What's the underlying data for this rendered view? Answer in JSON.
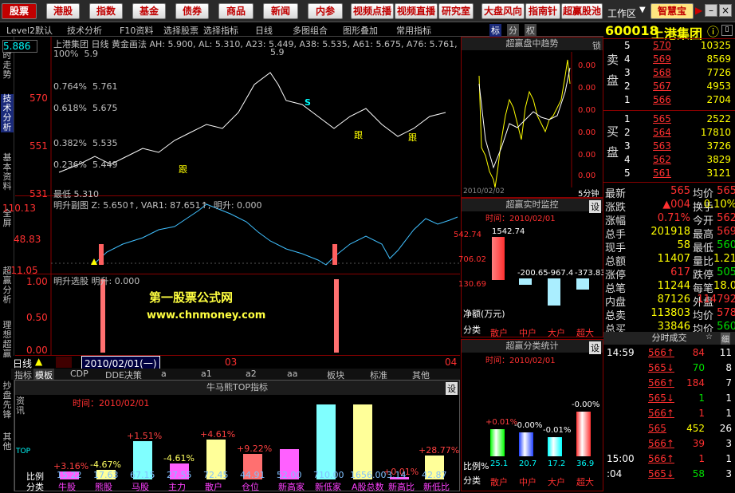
{
  "topbar": {
    "buttons": [
      "股票",
      "港股",
      "指数",
      "基金",
      "债券",
      "商品",
      "新闻",
      "内参",
      "视频点播",
      "视频直播",
      "研究室",
      "大盘风向",
      "指南针",
      "超赢股池"
    ],
    "workspace": "工作区",
    "smart": "智慧宝"
  },
  "toolrow": {
    "items": [
      "Level2默认",
      "技术分析",
      "F10资料",
      "选择股票",
      "选择指标",
      "日线",
      "多图组合",
      "图形叠加",
      "常用指标"
    ],
    "tabs": [
      "标",
      "分",
      "权"
    ]
  },
  "lefttabs": [
    "分时走势",
    "技术分析",
    "基本资料",
    "全屏",
    "超赢分析",
    "理想超赢"
  ],
  "stock": {
    "code": "600018",
    "name": "上港集团",
    "right_icon": "ⓘ"
  },
  "kline": {
    "header": "上港集团 日线 黄金画法 AH: 5.900, AL: 5.310, A23: 5.449, A38: 5.535, A61: 5.675, A76: 5.761, MA2: 5",
    "ylabels": [
      "5.886",
      "570",
      "551",
      "531"
    ],
    "fib": [
      {
        "pct": "100%",
        "v": "5.9"
      },
      {
        "pct": "0.764%",
        "v": "5.761"
      },
      {
        "pct": "0.618%",
        "v": "5.675"
      },
      {
        "pct": "0.382%",
        "v": "5.535"
      },
      {
        "pct": "0.236%",
        "v": "5.449"
      }
    ],
    "low_label": "最低 5.310",
    "marks": [
      "跟",
      "跟",
      "跟"
    ],
    "s": "S"
  },
  "sub1": {
    "header": "明升副图 Z: 5.650↑, VAR1: 87.651↑, 明升: 0.000",
    "ylabels": [
      "110.13",
      "48.83",
      "-11.05"
    ]
  },
  "sub2": {
    "header": "明升选股 明升: 0.000",
    "ylabels": [
      "1.00",
      "0.50",
      "0.00"
    ],
    "watermark1": "第一股票公式网",
    "watermark2": "www.chnmoney.com"
  },
  "datebar": {
    "period": "日线",
    "date": "2010/02/01(一)",
    "m3": "03",
    "m4": "04"
  },
  "bottomtabs": [
    "指标",
    "模板",
    "CDP",
    "DDE决策",
    "a",
    "a1",
    "a2",
    "aa",
    "板块",
    "标准",
    "其他"
  ],
  "bottom": {
    "title": "牛马熊TOP指标",
    "setting": "设",
    "time": "时间：2010/02/01",
    "side": [
      "资讯",
      "其他",
      "TOP"
    ],
    "left_labels": [
      "比例",
      "分类"
    ],
    "bars": [
      {
        "pct": "+3.16%",
        "val": "15.22",
        "name": "牛股",
        "color": "#ff60ff"
      },
      {
        "pct": "-4.67%",
        "val": "17.63",
        "name": "熊股",
        "color": "#ffff99"
      },
      {
        "pct": "+1.51%",
        "val": "67.15",
        "name": "马股",
        "color": "#80ffff"
      },
      {
        "pct": "-4.61%",
        "val": "27.55",
        "name": "主力",
        "color": "#ff60ff"
      },
      {
        "pct": "+4.61%",
        "val": "72.45",
        "name": "散户",
        "color": "#ffff99"
      },
      {
        "pct": "+9.22%",
        "val": "44.91",
        "name": "仓位",
        "color": "#ff7070"
      },
      {
        "pct": "",
        "val": "52.00",
        "name": "新高家",
        "color": "#ff60ff"
      },
      {
        "pct": "",
        "val": "710.00",
        "name": "新低家",
        "color": "#80ffff"
      },
      {
        "pct": "",
        "val": "1656.00",
        "name": "A股总数",
        "color": "#ffff99"
      },
      {
        "pct": "+0.01%",
        "val": "3.14",
        "name": "新高比",
        "color": "#ff60ff"
      },
      {
        "pct": "+28.77%",
        "val": "42.87",
        "name": "新低比",
        "color": "#ffff99"
      }
    ]
  },
  "mid": {
    "p1": {
      "title": "超赢盘中趋势",
      "lock": "锁",
      "date": "2010/02/02",
      "minute": "5分钟",
      "ylabels": [
        "0.00",
        "0.00",
        "0.00",
        "0.00",
        "0.00",
        "0.00"
      ]
    },
    "p2": {
      "title": "超赢实时监控",
      "setting": "设",
      "time": "时间：2010/02/01",
      "ylabels": [
        "542.74",
        "706.02",
        "130.69"
      ],
      "vals": [
        "1542.74",
        "-200.65",
        "-967.4",
        "-373.83"
      ],
      "net": "净额(万元)",
      "cats": [
        "散户",
        "中户",
        "大户",
        "超大"
      ],
      "catlabel": "分类"
    },
    "p3": {
      "title": "超赢分类统计",
      "setting": "设",
      "time": "时间：2010/02/01",
      "pcts": [
        "+0.01%",
        "-0.00%",
        "-0.01%",
        "-0.00%"
      ],
      "vals": [
        "25.1",
        "20.7",
        "17.2",
        "36.9"
      ],
      "cats": [
        "散户",
        "中户",
        "大户",
        "超大"
      ],
      "ratio": "比例%",
      "catlabel": "分类"
    }
  },
  "orderbook": {
    "sell_label": [
      "卖",
      "盘"
    ],
    "buy_label": [
      "买",
      "盘"
    ],
    "sells": [
      {
        "n": "5",
        "p": "570",
        "v": "10325"
      },
      {
        "n": "4",
        "p": "569",
        "v": "8569"
      },
      {
        "n": "3",
        "p": "568",
        "v": "7726"
      },
      {
        "n": "2",
        "p": "567",
        "v": "4953"
      },
      {
        "n": "1",
        "p": "566",
        "v": "2704"
      }
    ],
    "buys": [
      {
        "n": "1",
        "p": "565",
        "v": "2522"
      },
      {
        "n": "2",
        "p": "564",
        "v": "17810"
      },
      {
        "n": "3",
        "p": "563",
        "v": "3726"
      },
      {
        "n": "4",
        "p": "562",
        "v": "3829"
      },
      {
        "n": "5",
        "p": "561",
        "v": "3121"
      }
    ]
  },
  "quote": [
    {
      "a": "最新",
      "av": "565",
      "b": "均价",
      "bv": "565"
    },
    {
      "a": "涨跌",
      "av": "▲004",
      "b": "换手",
      "bv": "0.10%"
    },
    {
      "a": "涨幅",
      "av": "0.71%",
      "b": "今开",
      "bv": "562"
    },
    {
      "a": "总手",
      "av": "201918",
      "b": "最高",
      "bv": "569"
    },
    {
      "a": "现手",
      "av": "58",
      "b": "最低",
      "bv": "560"
    },
    {
      "a": "总额",
      "av": "11407",
      "b": "量比",
      "bv": "1.21"
    },
    {
      "a": "涨停",
      "av": "617",
      "b": "跌停",
      "bv": "505"
    },
    {
      "a": "总笔",
      "av": "11244",
      "b": "每笔",
      "bv": "18.0"
    },
    {
      "a": "内盘",
      "av": "87126",
      "b": "外盘",
      "bv": "114792"
    },
    {
      "a": "总卖",
      "av": "113803",
      "b": "均价",
      "bv": "578"
    },
    {
      "a": "总买",
      "av": "33846",
      "b": "均价",
      "bv": "560"
    }
  ],
  "ticks": {
    "title": "分时成交",
    "btn1": "☆",
    "btn2": "细",
    "rows": [
      {
        "t": "14:59",
        "p": "566↑",
        "v": "84",
        "n": "11"
      },
      {
        "t": "",
        "p": "565↓",
        "v": "70",
        "n": "8"
      },
      {
        "t": "",
        "p": "566↑",
        "v": "184",
        "n": "7"
      },
      {
        "t": "",
        "p": "565↓",
        "v": "1",
        "n": "1"
      },
      {
        "t": "",
        "p": "566↑",
        "v": "1",
        "n": "1"
      },
      {
        "t": "",
        "p": "565",
        "v": "452",
        "n": "26"
      },
      {
        "t": "",
        "p": "566↑",
        "v": "39",
        "n": "3"
      },
      {
        "t": "15:00",
        "p": "566↑",
        "v": "1",
        "n": "1"
      },
      {
        "t": ":04",
        "p": "565↓",
        "v": "58",
        "n": "3"
      }
    ]
  }
}
